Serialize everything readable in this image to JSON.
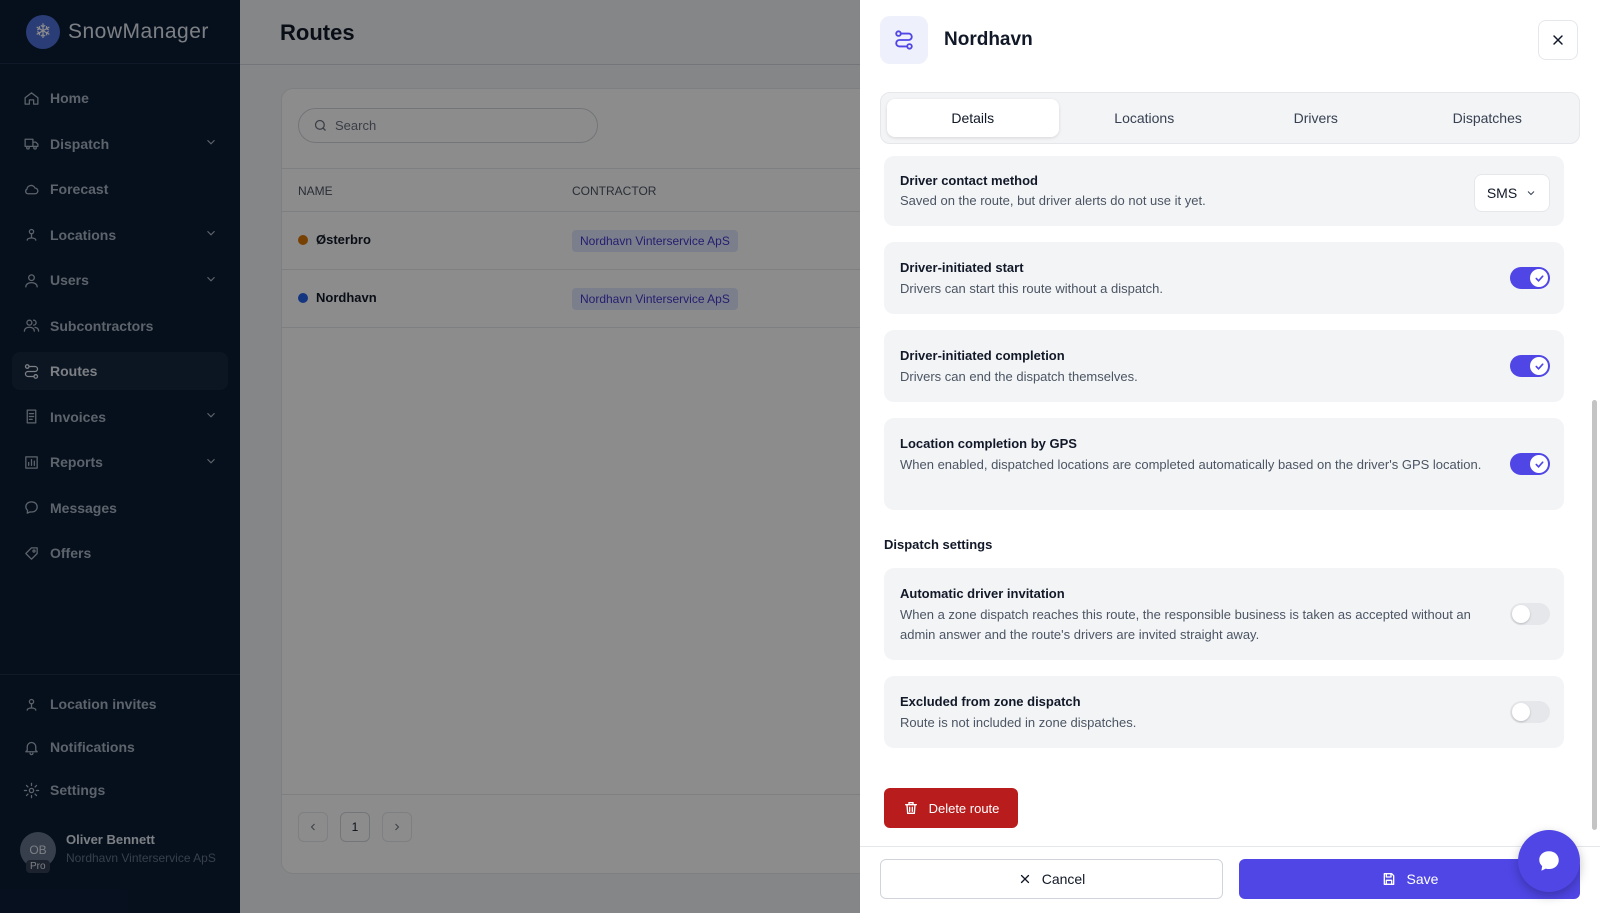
{
  "app": {
    "name": "SnowManager"
  },
  "sidebar": {
    "items": [
      {
        "label": "Home",
        "icon": "home-icon",
        "chevron": false
      },
      {
        "label": "Dispatch",
        "icon": "truck-icon",
        "chevron": true
      },
      {
        "label": "Forecast",
        "icon": "cloud-icon",
        "chevron": false
      },
      {
        "label": "Locations",
        "icon": "location-pin-icon",
        "chevron": true
      },
      {
        "label": "Users",
        "icon": "user-icon",
        "chevron": true
      },
      {
        "label": "Subcontractors",
        "icon": "users-icon",
        "chevron": false
      },
      {
        "label": "Routes",
        "icon": "route-icon",
        "chevron": false,
        "active": true
      },
      {
        "label": "Invoices",
        "icon": "invoice-icon",
        "chevron": true
      },
      {
        "label": "Reports",
        "icon": "chart-icon",
        "chevron": true
      },
      {
        "label": "Messages",
        "icon": "message-icon",
        "chevron": false
      },
      {
        "label": "Offers",
        "icon": "offer-icon",
        "chevron": false
      }
    ],
    "bottom_items": [
      {
        "label": "Location invites",
        "icon": "location-invite-icon"
      },
      {
        "label": "Notifications",
        "icon": "bell-icon"
      },
      {
        "label": "Settings",
        "icon": "gear-icon"
      }
    ],
    "user": {
      "initials": "OB",
      "badge": "Pro",
      "name": "Oliver Bennett",
      "org": "Nordhavn Vinterservice ApS"
    }
  },
  "main": {
    "title": "Routes",
    "search_placeholder": "Search",
    "columns": [
      "NAME",
      "CONTRACTOR"
    ],
    "rows": [
      {
        "name": "Østerbro",
        "color": "#d97706",
        "contractor": "Nordhavn Vinterservice ApS"
      },
      {
        "name": "Nordhavn",
        "color": "#2563eb",
        "contractor": "Nordhavn Vinterservice ApS"
      }
    ],
    "page": "1"
  },
  "panel": {
    "title": "Nordhavn",
    "tabs": [
      "Details",
      "Locations",
      "Drivers",
      "Dispatches"
    ],
    "active_tab": "Details",
    "contact": {
      "title": "Driver contact method",
      "desc": "Saved on the route, but driver alerts do not use it yet.",
      "value": "SMS"
    },
    "settings": [
      {
        "title": "Driver-initiated start",
        "desc": "Drivers can start this route without a dispatch.",
        "on": true
      },
      {
        "title": "Driver-initiated completion",
        "desc": "Drivers can end the dispatch themselves.",
        "on": true
      },
      {
        "title": "Location completion by GPS",
        "desc": "When enabled, dispatched locations are completed automatically based on the driver's GPS location.",
        "on": true
      }
    ],
    "dispatch_section_title": "Dispatch settings",
    "dispatch_settings": [
      {
        "title": "Automatic driver invitation",
        "desc": "When a zone dispatch reaches this route, the responsible business is taken as accepted without an admin answer and the route's drivers are invited straight away.",
        "on": false
      },
      {
        "title": "Excluded from zone dispatch",
        "desc": "Route is not included in zone dispatches.",
        "on": false
      }
    ],
    "delete_label": "Delete route",
    "cancel_label": "Cancel",
    "save_label": "Save"
  },
  "colors": {
    "accent": "#4f46e5",
    "danger": "#b91c1c",
    "sidebar": "#0b1e36"
  }
}
